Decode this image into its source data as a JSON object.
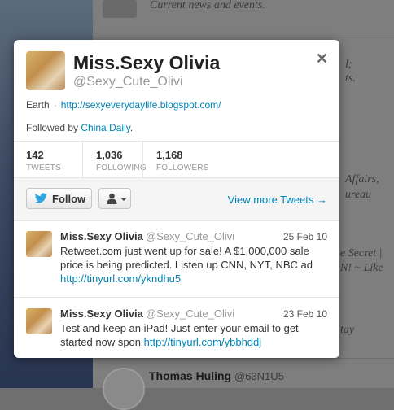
{
  "background": {
    "rows": [
      "Current news and events.",
      "l;",
      "ts.",
      "Affairs,",
      "ureau",
      "e Secret |",
      "N! ~ Like",
      "tay"
    ],
    "bottom_user": {
      "name": "Thomas Huling",
      "handle": "@63N1U5"
    }
  },
  "profile": {
    "name": "Miss.Sexy Olivia",
    "handle": "@Sexy_Cute_Olivi",
    "location": "Earth",
    "url": "http://sexyeverydaylife.blogspot.com/",
    "followed_by_prefix": "Followed by ",
    "followed_by_name": "China Daily",
    "followed_by_suffix": ".",
    "close_glyph": "✕"
  },
  "stats": [
    {
      "value": "142",
      "label": "TWEETS"
    },
    {
      "value": "1,036",
      "label": "FOLLOWING"
    },
    {
      "value": "1,168",
      "label": "FOLLOWERS"
    }
  ],
  "actions": {
    "follow_label": "Follow",
    "view_more": "View more Tweets →"
  },
  "tweets": [
    {
      "name": "Miss.Sexy Olivia",
      "handle": "@Sexy_Cute_Olivi",
      "date": "25 Feb 10",
      "text": "Retweet.com just went up for sale! A $1,000,000 sale price is being predicted. Listen up CNN, NYT, NBC ad ",
      "link": "http://tinyurl.com/ykndhu5"
    },
    {
      "name": "Miss.Sexy Olivia",
      "handle": "@Sexy_Cute_Olivi",
      "date": "23 Feb 10",
      "text": "Test and keep an iPad! Just enter your email to get started now spon ",
      "link": "http://tinyurl.com/ybbhddj"
    }
  ],
  "colors": {
    "link": "#0084b4",
    "twitter_blue": "#2fa6e0"
  }
}
